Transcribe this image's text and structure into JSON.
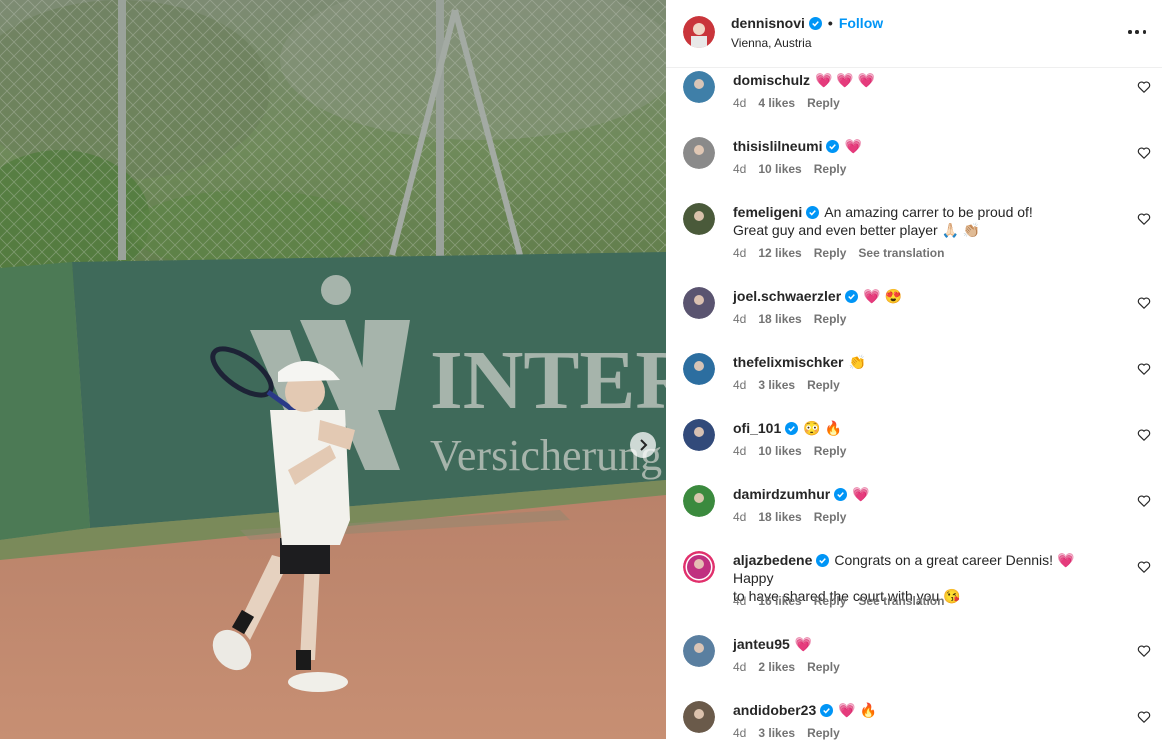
{
  "post": {
    "username": "dennisnovi",
    "follow_label": "Follow",
    "separator": "•",
    "location": "Vienna, Austria"
  },
  "photo": {
    "banner_brand": "INTERU",
    "banner_sub": "Versicherung",
    "accent": "#0095f6"
  },
  "comments": [
    {
      "user": "domischulz",
      "text": "💗 💗 💗",
      "time": "4d",
      "likes": "4 likes",
      "reply": "Reply",
      "verified": false
    },
    {
      "user": "thisislilneumi",
      "text": "💗",
      "time": "4d",
      "likes": "10 likes",
      "reply": "Reply",
      "verified": true
    },
    {
      "user": "femeligeni",
      "text": "An amazing carrer to be proud of!",
      "text2": "Great guy and even better player 🙏🏻 👏🏼",
      "time": "4d",
      "likes": "12 likes",
      "reply": "Reply",
      "translate": "See translation",
      "verified": true
    },
    {
      "user": "joel.schwaerzler",
      "text": "💗 😍",
      "time": "4d",
      "likes": "18 likes",
      "reply": "Reply",
      "verified": true
    },
    {
      "user": "thefelixmischker",
      "text": "👏",
      "time": "4d",
      "likes": "3 likes",
      "reply": "Reply",
      "verified": false
    },
    {
      "user": "ofi_101",
      "text": "😳 🔥",
      "time": "4d",
      "likes": "10 likes",
      "reply": "Reply",
      "verified": true
    },
    {
      "user": "damirdzumhur",
      "text": "💗",
      "time": "4d",
      "likes": "18 likes",
      "reply": "Reply",
      "verified": true
    },
    {
      "user": "aljazbedene",
      "text": "Congrats on a great career Dennis! 💗 Happy",
      "text2": "to have shared the court with you 😘",
      "time": "4d",
      "likes": "16 likes",
      "reply": "Reply",
      "translate": "See translation",
      "verified": true
    },
    {
      "user": "janteu95",
      "text": "💗",
      "time": "4d",
      "likes": "2 likes",
      "reply": "Reply",
      "verified": false
    },
    {
      "user": "andidober23",
      "text": "💗 🔥",
      "time": "4d",
      "likes": "3 likes",
      "reply": "Reply",
      "verified": true
    }
  ]
}
